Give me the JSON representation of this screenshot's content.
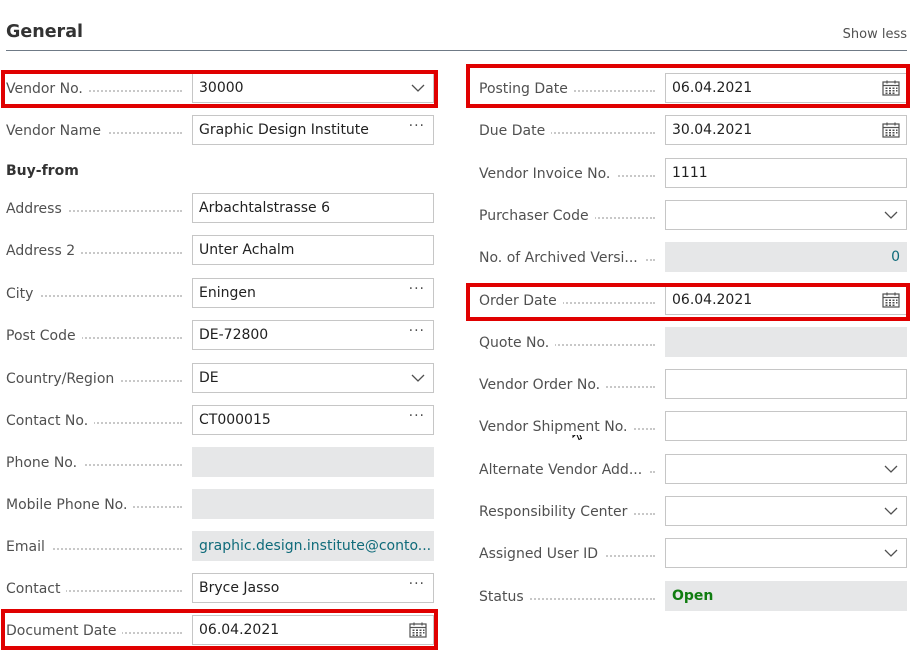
{
  "header": {
    "title": "General",
    "show_less": "Show less"
  },
  "left": {
    "vendor_no": {
      "label": "Vendor No.",
      "value": "30000"
    },
    "vendor_name": {
      "label": "Vendor Name",
      "value": "Graphic Design Institute"
    },
    "buy_from": "Buy-from",
    "address": {
      "label": "Address",
      "value": "Arbachtalstrasse 6"
    },
    "address2": {
      "label": "Address 2",
      "value": "Unter Achalm"
    },
    "city": {
      "label": "City",
      "value": "Eningen"
    },
    "post_code": {
      "label": "Post Code",
      "value": "DE-72800"
    },
    "country": {
      "label": "Country/Region",
      "value": "DE"
    },
    "contact_no": {
      "label": "Contact No.",
      "value": "CT000015"
    },
    "phone": {
      "label": "Phone No.",
      "value": ""
    },
    "mobile": {
      "label": "Mobile Phone No.",
      "value": ""
    },
    "email": {
      "label": "Email",
      "value": "graphic.design.institute@conto..."
    },
    "contact": {
      "label": "Contact",
      "value": "Bryce Jasso"
    },
    "document_date": {
      "label": "Document Date",
      "value": "06.04.2021"
    }
  },
  "right": {
    "posting_date": {
      "label": "Posting Date",
      "value": "06.04.2021"
    },
    "due_date": {
      "label": "Due Date",
      "value": "30.04.2021"
    },
    "vendor_invoice_no": {
      "label": "Vendor Invoice No.",
      "value": "1111"
    },
    "purchaser_code": {
      "label": "Purchaser Code",
      "value": ""
    },
    "archived_versions": {
      "label": "No. of Archived Versi...",
      "value": "0"
    },
    "order_date": {
      "label": "Order Date",
      "value": "06.04.2021"
    },
    "quote_no": {
      "label": "Quote No.",
      "value": ""
    },
    "vendor_order_no": {
      "label": "Vendor Order No.",
      "value": ""
    },
    "vendor_shipment_no": {
      "label": "Vendor Shipment No.",
      "value": ""
    },
    "alternate_vendor": {
      "label": "Alternate Vendor Add...",
      "value": ""
    },
    "responsibility_center": {
      "label": "Responsibility Center",
      "value": ""
    },
    "assigned_user": {
      "label": "Assigned User ID",
      "value": ""
    },
    "status": {
      "label": "Status",
      "value": "Open"
    }
  },
  "colors": {
    "highlight": "#e00000",
    "status_open": "#107c10",
    "link": "#0f6b7a"
  },
  "icons": {
    "dropdown": "chevron-down-icon",
    "lookup": "ellipsis-icon",
    "date": "calendar-icon"
  }
}
